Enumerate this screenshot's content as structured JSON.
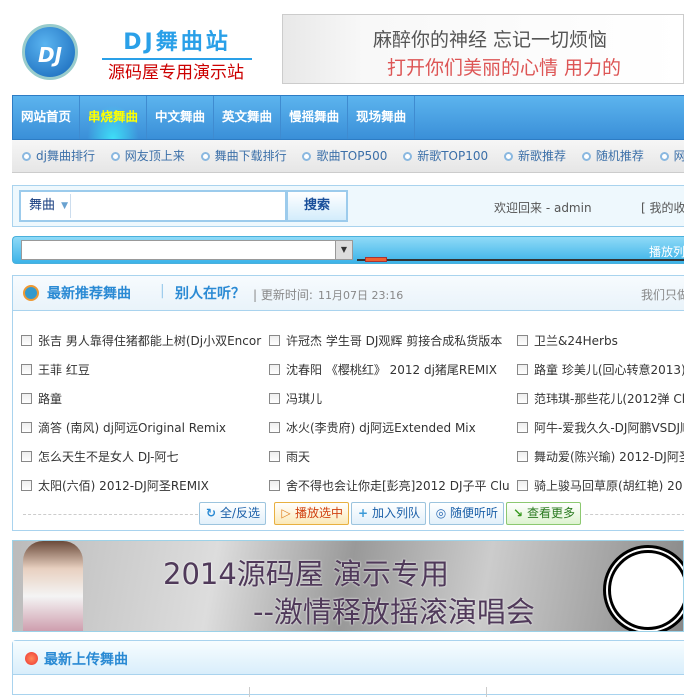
{
  "logo": {
    "mark": "DJ",
    "title": "DJ舞曲站",
    "subtitle": "源码屋专用演示站"
  },
  "banner": {
    "line1": "麻醉你的神经  忘记一切烦恼",
    "line2": "打开你们美丽的心情  用力的"
  },
  "nav": {
    "items": [
      "网站首页",
      "串烧舞曲",
      "中文舞曲",
      "英文舞曲",
      "慢摇舞曲",
      "现场舞曲"
    ],
    "active": 1
  },
  "subnav": {
    "items": [
      "dj舞曲排行",
      "网友顶上来",
      "舞曲下载排行",
      "歌曲TOP500",
      "新歌TOP100",
      "新歌推荐",
      "随机推荐",
      "网"
    ]
  },
  "search": {
    "type": "舞曲",
    "value": "",
    "button": "搜索",
    "welcome": "欢迎回来 - admin",
    "fav": "[ 我的收"
  },
  "player": {
    "playlist_label": "播放列",
    "selected": "",
    "progress": 0.02
  },
  "recommend": {
    "title": "最新推荐舞曲",
    "sep": "|",
    "other": "别人在听？",
    "updated_label": "| 更新时间:",
    "updated_time": "11月07日 23:16",
    "note": "我们只做",
    "songs": [
      [
        "张吉 男人靠得住猪都能上树(Dj小双Encor",
        "许冠杰 学生哥 DJ观辉 剪接合成私货版本",
        "卫兰&24Herbs"
      ],
      [
        "王菲 红豆",
        "沈春阳 《樱桃红》 2012 dj猪尾REMIX",
        "路童 珍美儿(回心转意2013)"
      ],
      [
        "路童",
        "冯琪儿",
        "范玮琪-那些花儿(2012弹 Cl"
      ],
      [
        "滴答 (南风) dj阿远Original Remix",
        "冰火(李贵府) dj阿远Extended Mix",
        "阿牛-爱我久久-DJ阿鹏VSDJ顺"
      ],
      [
        "怎么天生不是女人 DJ-阿七",
        "雨天",
        "舞动爱(陈兴瑜) 2012-DJ阿圣"
      ],
      [
        "太阳(六佰) 2012-DJ阿圣REMIX",
        "舍不得也会让你走[彭亮]2012 DJ子平 Clu",
        "骑上骏马回草原(胡红艳) 20"
      ]
    ],
    "buttons": [
      "全/反选",
      "播放选中",
      "加入列队",
      "随便听听",
      "查看更多"
    ]
  },
  "ad": {
    "line1": "2014源码屋  演示专用",
    "line2": "--激情释放摇滚演唱会"
  },
  "upload": {
    "title": "最新上传舞曲"
  }
}
